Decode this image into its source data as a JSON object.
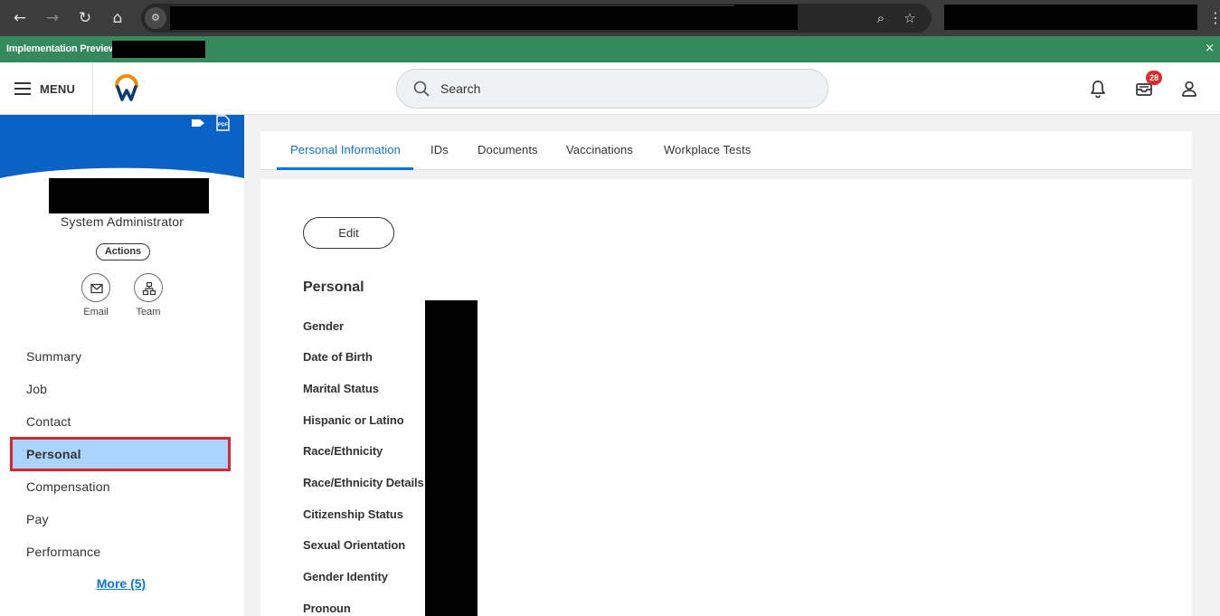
{
  "browser": {
    "back_icon": "arrow-left-icon",
    "forward_icon": "arrow-right-icon",
    "reload_icon": "reload-icon",
    "home_icon": "home-icon",
    "site_info_icon": "tune-icon",
    "zoom_icon": "zoom-icon",
    "bookmark_icon": "star-icon",
    "menu_icon": "kebab-icon"
  },
  "banner": {
    "label": "Implementation Preview",
    "close_glyph": "×",
    "color": "#358a5d"
  },
  "header": {
    "menu_label": "MENU",
    "search_placeholder": "Search",
    "inbox_badge": "28",
    "badge_color": "#de2b2b"
  },
  "profile": {
    "role": "System Administrator",
    "actions_label": "Actions",
    "quick_actions": [
      {
        "label": "Email",
        "icon": "envelope-icon"
      },
      {
        "label": "Team",
        "icon": "org-chart-icon"
      }
    ],
    "cover_color": "#0a62c6"
  },
  "sidebar": {
    "items": [
      {
        "label": "Summary",
        "active": false
      },
      {
        "label": "Job",
        "active": false
      },
      {
        "label": "Contact",
        "active": false
      },
      {
        "label": "Personal",
        "active": true
      },
      {
        "label": "Compensation",
        "active": false
      },
      {
        "label": "Pay",
        "active": false
      },
      {
        "label": "Performance",
        "active": false
      }
    ],
    "more_label": "More (5)",
    "active_color": "#aad4fb",
    "highlight_color": "#e0222f"
  },
  "tabs": [
    {
      "label": "Personal Information",
      "active": true
    },
    {
      "label": "IDs",
      "active": false
    },
    {
      "label": "Documents",
      "active": false
    },
    {
      "label": "Vaccinations",
      "active": false
    },
    {
      "label": "Workplace Tests",
      "active": false
    }
  ],
  "content": {
    "edit_label": "Edit",
    "section_title": "Personal",
    "fields": [
      "Gender",
      "Date of Birth",
      "Marital Status",
      "Hispanic or Latino",
      "Race/Ethnicity",
      "Race/Ethnicity Details",
      "Citizenship Status",
      "Sexual Orientation",
      "Gender Identity",
      "Pronoun"
    ],
    "accent_color": "#0875e1"
  }
}
